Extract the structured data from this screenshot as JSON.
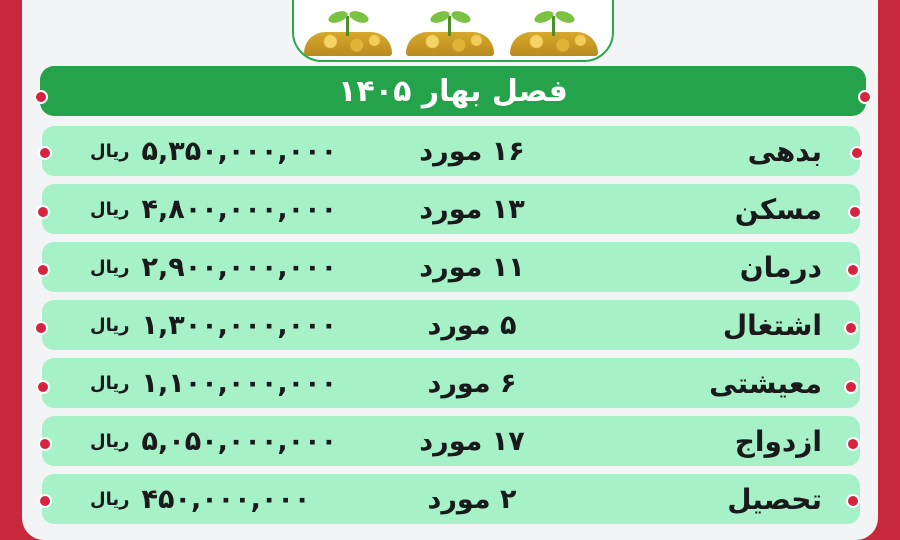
{
  "header": {
    "title": "فصل بهار ۱۴۰۵"
  },
  "rows": [
    {
      "category": "بدهی",
      "count": "۱۶ مورد",
      "amount": "۵,۳۵۰,۰۰۰,۰۰۰",
      "currency": "ریال"
    },
    {
      "category": "مسکن",
      "count": "۱۳ مورد",
      "amount": "۴,۸۰۰,۰۰۰,۰۰۰",
      "currency": "ریال"
    },
    {
      "category": "درمان",
      "count": "۱۱ مورد",
      "amount": "۲,۹۰۰,۰۰۰,۰۰۰",
      "currency": "ریال"
    },
    {
      "category": "اشتغال",
      "count": "۵ مورد",
      "amount": "۱,۳۰۰,۰۰۰,۰۰۰",
      "currency": "ریال"
    },
    {
      "category": "معیشتی",
      "count": "۶ مورد",
      "amount": "۱,۱۰۰,۰۰۰,۰۰۰",
      "currency": "ریال"
    },
    {
      "category": "ازدواج",
      "count": "۱۷ مورد",
      "amount": "۵,۰۵۰,۰۰۰,۰۰۰",
      "currency": "ریال"
    },
    {
      "category": "تحصیل",
      "count": "۲ مورد",
      "amount": "۴۵۰,۰۰۰,۰۰۰",
      "currency": "ریال"
    }
  ],
  "colors": {
    "background": "#c8283c",
    "title_bar": "#24a34a",
    "row": "#a6f1c8",
    "dot": "#d7233f"
  },
  "icons": {
    "header_image": "coin-piles-with-seedlings"
  }
}
